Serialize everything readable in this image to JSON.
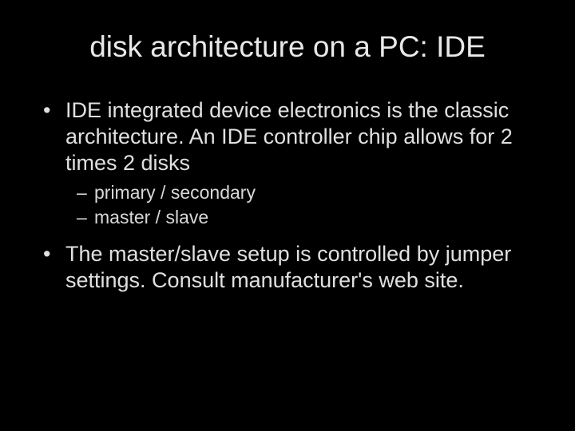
{
  "title": "disk architecture on a PC: IDE",
  "bullets": [
    {
      "text": "IDE integrated device electronics is the classic architecture. An IDE controller chip allows for 2 times 2 disks",
      "subbullets": [
        "primary / secondary",
        "master / slave"
      ]
    },
    {
      "text": "The master/slave setup is controlled by jumper settings. Consult manufacturer's web site."
    }
  ]
}
